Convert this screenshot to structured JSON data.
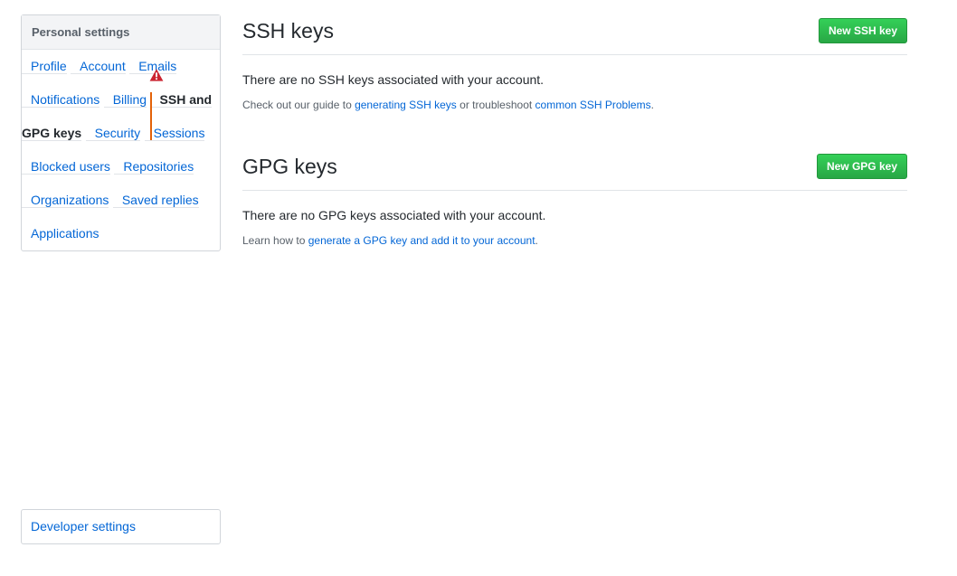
{
  "sidebar": {
    "heading": "Personal settings",
    "items": [
      {
        "label": "Profile"
      },
      {
        "label": "Account"
      },
      {
        "label": "Emails",
        "icon": "alert-icon",
        "icon_color": "#cb2431"
      },
      {
        "label": "Notifications"
      },
      {
        "label": "Billing"
      },
      {
        "label": "SSH and GPG keys",
        "selected": true
      },
      {
        "label": "Security"
      },
      {
        "label": "Sessions"
      },
      {
        "label": "Blocked users"
      },
      {
        "label": "Repositories"
      },
      {
        "label": "Organizations"
      },
      {
        "label": "Saved replies"
      },
      {
        "label": "Applications"
      }
    ],
    "developer_settings": "Developer settings"
  },
  "ssh": {
    "title": "SSH keys",
    "button": "New SSH key",
    "empty": "There are no SSH keys associated with your account.",
    "help_prefix": "Check out our guide to ",
    "help_link1": "generating SSH keys",
    "help_middle": " or troubleshoot ",
    "help_link2": "common SSH Problems",
    "help_suffix": "."
  },
  "gpg": {
    "title": "GPG keys",
    "button": "New GPG key",
    "empty": "There are no GPG keys associated with your account.",
    "help_prefix": "Learn how to ",
    "help_link": "generate a GPG key and add it to your account",
    "help_suffix": "."
  },
  "colors": {
    "link": "#0366d6",
    "button_green": "#28a745",
    "selected_indicator": "#e36209",
    "alert": "#cb2431"
  }
}
